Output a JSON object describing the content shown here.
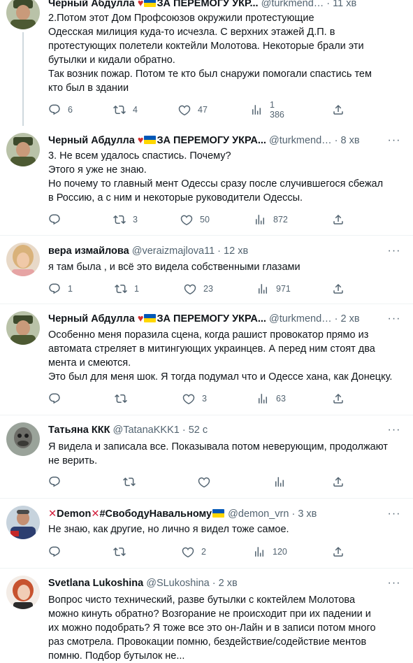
{
  "tweets": [
    {
      "id": "t1",
      "name": "Черный Абдулла",
      "handle": "@turkmend…",
      "time": "11 хв",
      "lines": [
        "2.Потом этот Дом Профсоюзов окружили протестующие",
        "Одесская милиция куда-то исчезла. С верхних этажей Д.П. в",
        "протестующих полетели коктейли Молотова.  Некоторые брали эти",
        "бутылки и кидали обратно.",
        "Так возник пожар. Потом те кто был снаружи помогали спастись тем",
        "кто был в здании"
      ],
      "counts": {
        "replies": "6",
        "retweets": "4",
        "likes": "47",
        "views": "1 386"
      }
    },
    {
      "id": "t2",
      "name": "Черный Абдулла",
      "name_suffix": "ЗА ПЕРЕМОГУ УКРА...",
      "handle": "@turkmend…",
      "time": "8 хв",
      "lines": [
        "3. Не всем удалось спастись. Почему?",
        "Этого я уже не знаю.",
        "Но почему то главный мент Одессы сразу после случившегося сбежал",
        "в Россию, а с ним и некоторые руководители Одессы."
      ],
      "counts": {
        "replies": "",
        "retweets": "3",
        "likes": "50",
        "views": "872"
      }
    },
    {
      "id": "t3",
      "name": "вера измайлова",
      "handle": "@veraizmajlova11",
      "time": "12 хв",
      "lines": [
        "я там была , и всё это видела собственными глазами"
      ],
      "counts": {
        "replies": "1",
        "retweets": "1",
        "likes": "23",
        "views": "971"
      }
    },
    {
      "id": "t4",
      "name": "Черный Абдулла",
      "name_suffix": "ЗА ПЕРЕМОГУ УКРА...",
      "handle": "@turkmend…",
      "time": "2 хв",
      "lines": [
        "Особенно меня поразила сцена, когда рашист провокатор прямо из",
        "автомата стреляет в митингующих украинцев. А перед ним стоят два",
        "мента и смеются.",
        "Это был для меня шок. Я тогда подумал что и Одессе хана, как Донецку."
      ],
      "counts": {
        "replies": "",
        "retweets": "",
        "likes": "3",
        "views": "63"
      }
    },
    {
      "id": "t5",
      "name": "Татьяна ККК",
      "handle": "@TatanaKKK1",
      "time": "52 с",
      "lines": [
        "Я видела и записала все. Показывала потом неверующим, продолжают",
        "не верить."
      ],
      "counts": {
        "replies": "",
        "retweets": "",
        "likes": "",
        "views": ""
      }
    },
    {
      "id": "t6",
      "name_pre": "Demon",
      "name": "#СвободуНавальному",
      "handle": "@demon_vrn",
      "time": "3 хв",
      "lines": [
        "Не знаю, как другие, но лично я видел тоже самое."
      ],
      "counts": {
        "replies": "",
        "retweets": "",
        "likes": "2",
        "views": "120"
      }
    },
    {
      "id": "t7",
      "name": "Svetlana Lukoshina",
      "handle": "@SLukoshina",
      "time": "2 хв",
      "lines": [
        "Вопрос чисто технический, разве бутылки с коктейлем Молотова",
        "можно кинуть обратно? Возгорание не происходит при их падении и",
        "их можно подобрать? Я тоже все это он-Лайн  и в записи потом много",
        "раз смотрела. Провокации помню, бездействие/содействие ментов",
        "помню. Подбор бутылок не..."
      ],
      "counts": {
        "replies": "",
        "retweets": "",
        "likes": "",
        "views": ""
      }
    }
  ],
  "t1_name_suffix": "ЗА ПЕРЕМОГУ УКР...",
  "icons": {
    "reply": "reply-icon",
    "retweet": "retweet-icon",
    "like": "heart-icon",
    "views": "analytics-icon",
    "share": "share-icon",
    "more": "more-icon"
  },
  "colors": {
    "text": "#0f1419",
    "muted": "#536471",
    "thread_line": "#cfd9de",
    "flag_blue": "#0057b7",
    "flag_yellow": "#ffd700",
    "heart": "#d32f2f"
  }
}
